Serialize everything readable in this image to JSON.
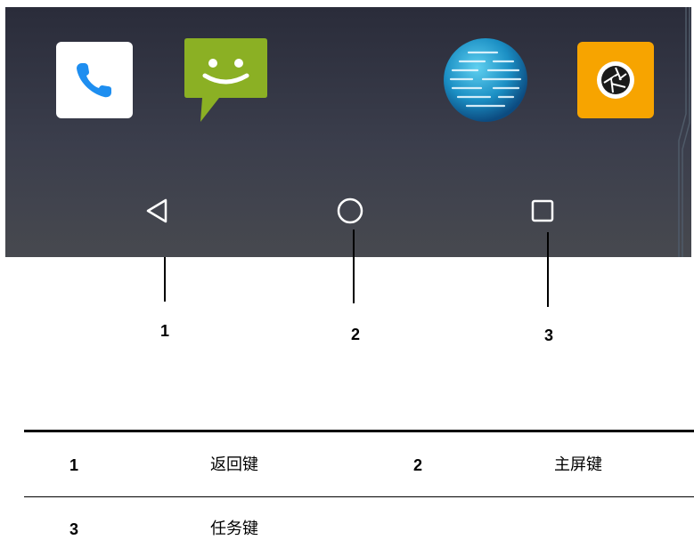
{
  "screenshot": {
    "apps": [
      {
        "name": "phone-app-icon",
        "icon": "phone-icon"
      },
      {
        "name": "messages-app-icon",
        "icon": "message-smiley-icon"
      },
      {
        "name": "browser-app-icon",
        "icon": "globe-icon"
      },
      {
        "name": "camera-app-icon",
        "icon": "camera-aperture-icon"
      }
    ],
    "nav_buttons": [
      {
        "icon": "back-triangle-icon"
      },
      {
        "icon": "home-circle-icon"
      },
      {
        "icon": "recent-square-icon"
      }
    ],
    "colors": {
      "phone_blue": "#1e8ef0",
      "message_green": "#8bb024",
      "globe_blue": "#1da3d8",
      "camera_orange": "#f7a400"
    }
  },
  "callouts": [
    "1",
    "2",
    "3"
  ],
  "legend": {
    "rows": [
      [
        {
          "num": "1",
          "label": "返回键"
        },
        {
          "num": "2",
          "label": "主屏键"
        }
      ],
      [
        {
          "num": "3",
          "label": "任务键"
        }
      ]
    ]
  }
}
